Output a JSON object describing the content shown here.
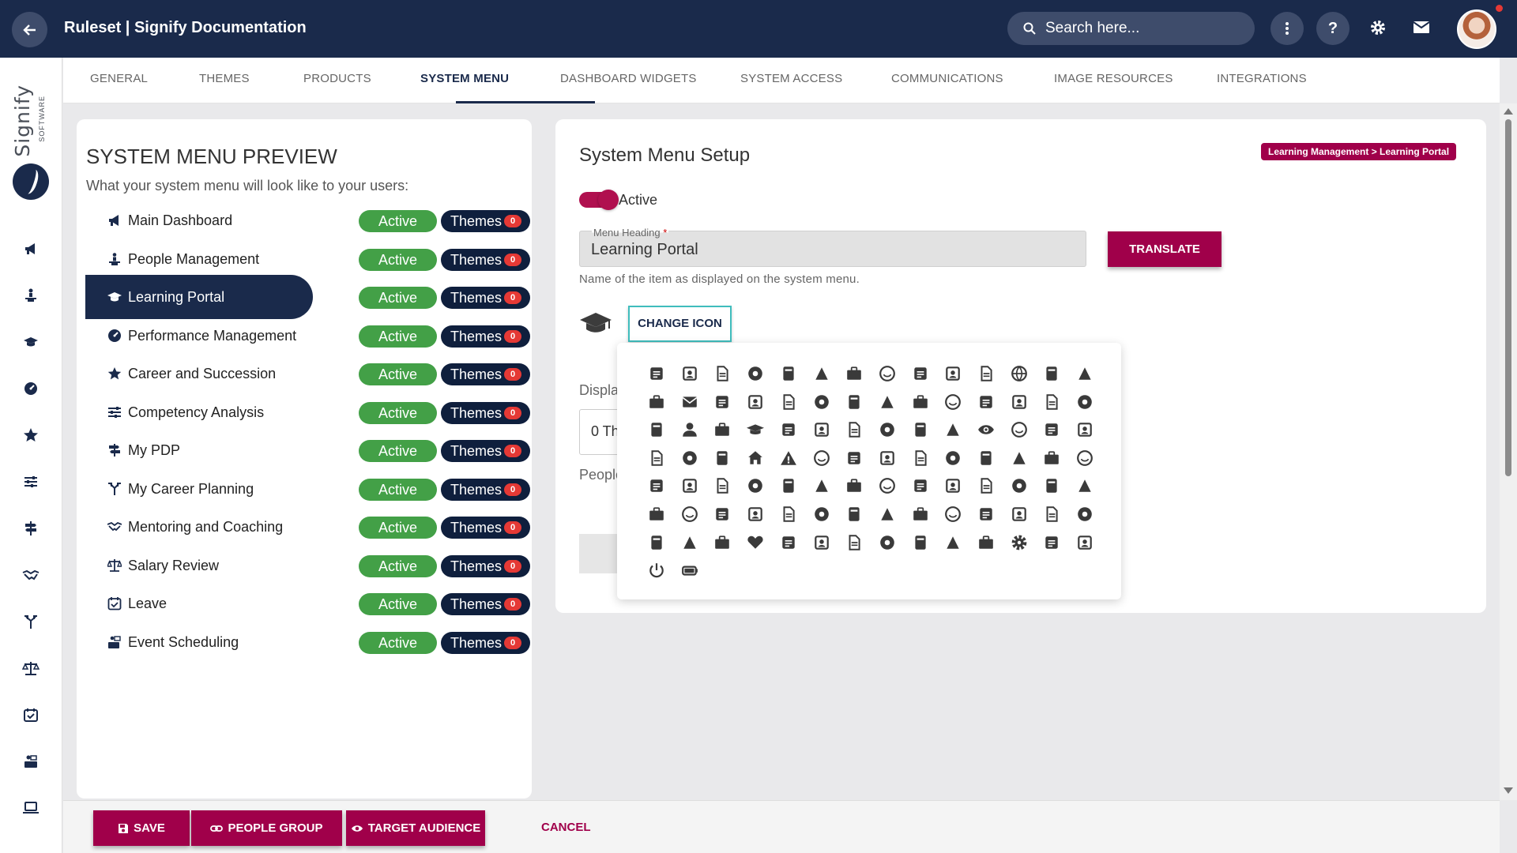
{
  "app": {
    "title": "Ruleset | Signify Documentation",
    "search_placeholder": "Search here..."
  },
  "logo": {
    "name": "Signify",
    "sub": "SOFTWARE"
  },
  "tabs": [
    "GENERAL",
    "THEMES",
    "PRODUCTS",
    "SYSTEM MENU",
    "DASHBOARD WIDGETS",
    "SYSTEM ACCESS",
    "COMMUNICATIONS",
    "IMAGE RESOURCES",
    "INTEGRATIONS"
  ],
  "active_tab": "SYSTEM MENU",
  "preview": {
    "title": "SYSTEM MENU PREVIEW",
    "subtitle": "What your system menu will look like to your users:",
    "active_label": "Active",
    "themes_label": "Themes",
    "items": [
      {
        "label": "Main Dashboard",
        "icon": "megaphone-icon",
        "themes_count": "0"
      },
      {
        "label": "People Management",
        "icon": "person-podium-icon",
        "themes_count": "0"
      },
      {
        "label": "Learning Portal",
        "icon": "graduation-cap-icon",
        "themes_count": "0",
        "selected": true
      },
      {
        "label": "Performance Management",
        "icon": "gauge-icon",
        "themes_count": "0"
      },
      {
        "label": "Career and Succession",
        "icon": "star-icon",
        "themes_count": "0"
      },
      {
        "label": "Competency Analysis",
        "icon": "sliders-icon",
        "themes_count": "0"
      },
      {
        "label": "My PDP",
        "icon": "signpost-icon",
        "themes_count": "0"
      },
      {
        "label": "My Career Planning",
        "icon": "split-arrows-icon",
        "themes_count": "0"
      },
      {
        "label": "Mentoring and Coaching",
        "icon": "handshake-icon",
        "themes_count": "0"
      },
      {
        "label": "Salary Review",
        "icon": "scales-icon",
        "themes_count": "0"
      },
      {
        "label": "Leave",
        "icon": "calendar-check-icon",
        "themes_count": "0"
      },
      {
        "label": "Event Scheduling",
        "icon": "person-board-icon",
        "themes_count": "0"
      }
    ]
  },
  "setup": {
    "title": "System Menu Setup",
    "breadcrumb": "Learning Management > Learning Portal",
    "toggle_label": "Active",
    "menu_heading_label": "Menu Heading",
    "menu_heading_value": "Learning Portal",
    "hint": "Name of the item as displayed on the system menu.",
    "translate_label": "TRANSLATE",
    "change_icon_label": "CHANGE ICON",
    "hidden_label_1": "Displa",
    "hidden_input_value": "0 Th",
    "hidden_label_2": "People"
  },
  "picker_icons": [
    "address-card-icon",
    "id-card-icon",
    "contact-book-icon",
    "newspaper-icon",
    "file-text-icon",
    "file-lines-icon",
    "file-code-icon",
    "file-image-icon",
    "file-icon",
    "clipboard-icon",
    "book-icon",
    "globe-icon",
    "briefcase-icon",
    "archive-icon",
    "inbox-icon",
    "envelope-icon",
    "map-icon",
    "envelope-open-icon",
    "tags-icon",
    "frame-icon",
    "edit-icon",
    "brush-icon",
    "pencil-icon",
    "pen-icon",
    "gauge-icon",
    "paperclip-icon",
    "smile-icon",
    "user-circle-icon",
    "user-secret-icon",
    "user-icon",
    "users-icon",
    "graduation-cap-icon",
    "person-podium-icon",
    "person-icon",
    "child-icon",
    "hands-clap-icon",
    "thumbs-up-icon",
    "handshake-icon",
    "eye-icon",
    "door-icon",
    "bullhorn-icon",
    "building-icon",
    "hospital-icon",
    "industry-icon",
    "bank-icon",
    "home-icon",
    "warning-icon",
    "road-icon",
    "map-pin-icon",
    "signpost-icon",
    "car-icon",
    "thumbtack-icon",
    "lightbulb-icon",
    "location-icon",
    "bug-icon",
    "bookmark-icon",
    "certificate-icon",
    "trophy-icon",
    "flag-icon",
    "rocket-icon",
    "chart-bar-icon",
    "chart-pie-icon",
    "bell-icon",
    "desktop-icon",
    "laptop-icon",
    "mobile-icon",
    "comment-icon",
    "comments-icon",
    "scales-icon",
    "hourglass-icon",
    "birthday-cake-icon",
    "cocktail-icon",
    "coffee-icon",
    "trash-icon",
    "camera-icon",
    "gift-icon",
    "money-icon",
    "paper-plane-icon",
    "puzzle-icon",
    "umbrella-icon",
    "football-icon",
    "life-ring-icon",
    "gem-icon",
    "gender-icon",
    "basket-icon",
    "shopping-bag-icon",
    "key-icon",
    "heart-icon",
    "sitemap-icon",
    "table-icon",
    "sliders-icon",
    "list-icon",
    "calendar-icon",
    "calculator-icon",
    "barcode-icon",
    "cog-icon",
    "database-icon",
    "recycle-icon",
    "power-icon",
    "battery-icon"
  ],
  "bottom": {
    "save": "SAVE",
    "people_group": "PEOPLE GROUP",
    "target_audience": "TARGET AUDIENCE",
    "cancel": "CANCEL"
  },
  "colors": {
    "navy": "#1a2a4b",
    "accent": "#a0004a",
    "active_green": "#43a047",
    "badge_red": "#e53935",
    "teal_outline": "#3fbdbd"
  }
}
